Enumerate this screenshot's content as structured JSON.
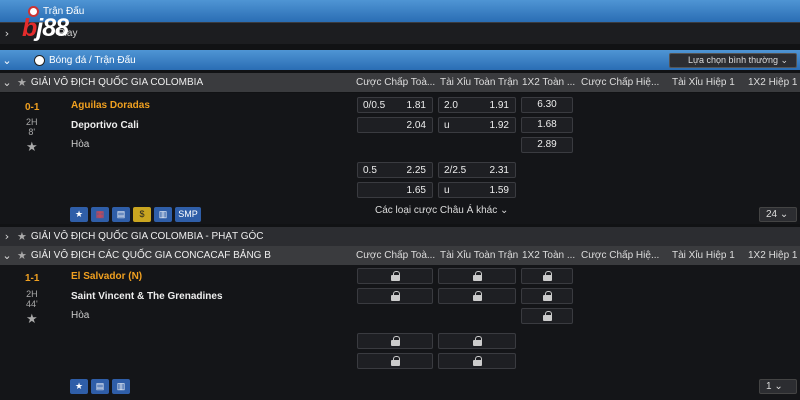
{
  "top_bar": {
    "label": "Trận Đấu"
  },
  "play_row": {
    "label": "Play"
  },
  "breadcrumb": {
    "label": "Bóng đá / Trận Đấu",
    "sort_label": "Lựa chọn bình thường"
  },
  "logo": {
    "text": "bj88",
    "sub": "BJ88"
  },
  "columns": [
    "Cược Chấp Toà...",
    "Tài Xỉu Toàn Trận",
    "1X2 Toàn ...",
    "Cược Chấp Hiệ...",
    "Tài Xỉu Hiệp 1",
    "1X2 Hiệp 1"
  ],
  "league1": {
    "name": "GIẢI VÔ ĐỊCH QUỐC GIA COLOMBIA",
    "score": "0-1",
    "period": "2H",
    "minute": "8'",
    "home": "Aguilas Doradas",
    "away": "Deportivo Cali",
    "draw": "Hòa",
    "odds": {
      "r1": {
        "hcap": "0/0.5",
        "hcap_o": "1.81",
        "ou": "2.0",
        "ou_o": "1.91",
        "x12": "6.30"
      },
      "r2": {
        "hcap_o": "2.04",
        "ou": "u",
        "ou_o": "1.92",
        "x12": "1.68"
      },
      "r3": {
        "x12": "2.89"
      },
      "r4": {
        "hcap": "0.5",
        "hcap_o": "2.25",
        "ou": "2/2.5",
        "ou_o": "2.31"
      },
      "r5": {
        "hcap_o": "1.65",
        "ou": "u",
        "ou_o": "1.59"
      }
    },
    "more_label": "Các loại cược Châu Á khác",
    "tools": {
      "smp": "SMP"
    },
    "page": "24"
  },
  "league_corner": {
    "name": "GIẢI VÔ ĐỊCH QUỐC GIA COLOMBIA - PHẠT GÓC"
  },
  "league2": {
    "name": "GIẢI VÔ ĐỊCH CÁC QUỐC GIA CONCACAF BẢNG B",
    "score": "1-1",
    "period": "2H",
    "minute": "44'",
    "home": "El Salvador (N)",
    "away": "Saint Vincent & The Grenadines",
    "draw": "Hòa",
    "page": "1"
  },
  "colors": {
    "accent": "#f0a020",
    "bar": "#2a6db4"
  }
}
